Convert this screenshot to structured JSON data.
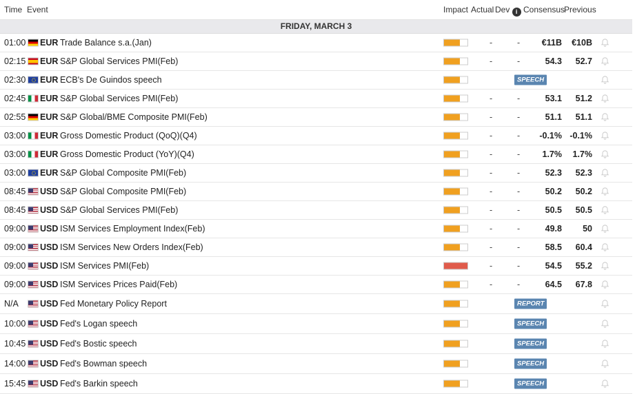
{
  "header": {
    "time": "Time",
    "event": "Event",
    "impact": "Impact",
    "actual": "Actual",
    "dev": "Dev",
    "info": "i",
    "consensus": "Consensus",
    "previous": "Previous"
  },
  "day_label": "FRIDAY, MARCH 3",
  "colors": {
    "impact_medium": "#f0a020",
    "impact_high": "#e05b4b",
    "badge": "#5a85b0"
  },
  "rows": [
    {
      "time": "01:00",
      "flag": "de",
      "currency": "EUR",
      "event": "Trade Balance s.a.(Jan)",
      "impact": "medium",
      "actual": "-",
      "dev": "-",
      "consensus": "€11B",
      "previous": "€10B"
    },
    {
      "time": "02:15",
      "flag": "es",
      "currency": "EUR",
      "event": "S&P Global Services PMI(Feb)",
      "impact": "medium",
      "actual": "-",
      "dev": "-",
      "consensus": "54.3",
      "previous": "52.7"
    },
    {
      "time": "02:30",
      "flag": "eu",
      "currency": "EUR",
      "event": "ECB's De Guindos speech",
      "impact": "medium",
      "badge": "SPEECH"
    },
    {
      "time": "02:45",
      "flag": "it",
      "currency": "EUR",
      "event": "S&P Global Services PMI(Feb)",
      "impact": "medium",
      "actual": "-",
      "dev": "-",
      "consensus": "53.1",
      "previous": "51.2"
    },
    {
      "time": "02:55",
      "flag": "de",
      "currency": "EUR",
      "event": "S&P Global/BME Composite PMI(Feb)",
      "impact": "medium",
      "actual": "-",
      "dev": "-",
      "consensus": "51.1",
      "previous": "51.1"
    },
    {
      "time": "03:00",
      "flag": "it",
      "currency": "EUR",
      "event": "Gross Domestic Product (QoQ)(Q4)",
      "impact": "medium",
      "actual": "-",
      "dev": "-",
      "consensus": "-0.1%",
      "previous": "-0.1%"
    },
    {
      "time": "03:00",
      "flag": "it",
      "currency": "EUR",
      "event": "Gross Domestic Product (YoY)(Q4)",
      "impact": "medium",
      "actual": "-",
      "dev": "-",
      "consensus": "1.7%",
      "previous": "1.7%"
    },
    {
      "time": "03:00",
      "flag": "eu",
      "currency": "EUR",
      "event": "S&P Global Composite PMI(Feb)",
      "impact": "medium",
      "actual": "-",
      "dev": "-",
      "consensus": "52.3",
      "previous": "52.3"
    },
    {
      "time": "08:45",
      "flag": "us",
      "currency": "USD",
      "event": "S&P Global Composite PMI(Feb)",
      "impact": "medium",
      "actual": "-",
      "dev": "-",
      "consensus": "50.2",
      "previous": "50.2"
    },
    {
      "time": "08:45",
      "flag": "us",
      "currency": "USD",
      "event": "S&P Global Services PMI(Feb)",
      "impact": "medium",
      "actual": "-",
      "dev": "-",
      "consensus": "50.5",
      "previous": "50.5"
    },
    {
      "time": "09:00",
      "flag": "us",
      "currency": "USD",
      "event": "ISM Services Employment Index(Feb)",
      "impact": "medium",
      "actual": "-",
      "dev": "-",
      "consensus": "49.8",
      "previous": "50"
    },
    {
      "time": "09:00",
      "flag": "us",
      "currency": "USD",
      "event": "ISM Services New Orders Index(Feb)",
      "impact": "medium",
      "actual": "-",
      "dev": "-",
      "consensus": "58.5",
      "previous": "60.4"
    },
    {
      "time": "09:00",
      "flag": "us",
      "currency": "USD",
      "event": "ISM Services PMI(Feb)",
      "impact": "high",
      "actual": "-",
      "dev": "-",
      "consensus": "54.5",
      "previous": "55.2"
    },
    {
      "time": "09:00",
      "flag": "us",
      "currency": "USD",
      "event": "ISM Services Prices Paid(Feb)",
      "impact": "medium",
      "actual": "-",
      "dev": "-",
      "consensus": "64.5",
      "previous": "67.8"
    },
    {
      "time": "N/A",
      "flag": "us",
      "currency": "USD",
      "event": "Fed Monetary Policy Report",
      "impact": "medium",
      "badge": "REPORT",
      "tall": true
    },
    {
      "time": "10:00",
      "flag": "us",
      "currency": "USD",
      "event": "Fed's Logan speech",
      "impact": "medium",
      "badge": "SPEECH",
      "tall": true
    },
    {
      "time": "10:45",
      "flag": "us",
      "currency": "USD",
      "event": "Fed's Bostic speech",
      "impact": "medium",
      "badge": "SPEECH",
      "tall": true
    },
    {
      "time": "14:00",
      "flag": "us",
      "currency": "USD",
      "event": "Fed's Bowman speech",
      "impact": "medium",
      "badge": "SPEECH",
      "tall": true
    },
    {
      "time": "15:45",
      "flag": "us",
      "currency": "USD",
      "event": "Fed's Barkin speech",
      "impact": "medium",
      "badge": "SPEECH",
      "tall": true
    }
  ]
}
